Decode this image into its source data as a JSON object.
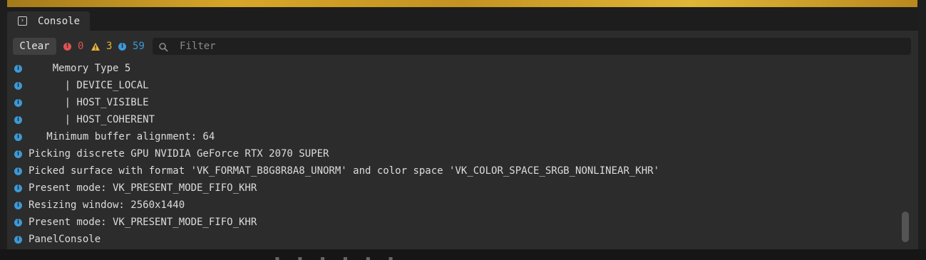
{
  "colors": {
    "error": "#e05252",
    "warning": "#e8b33a",
    "info": "#3c9ad8"
  },
  "tab": {
    "label": "Console",
    "icon": "terminal-icon"
  },
  "toolbar": {
    "clear_label": "Clear",
    "errors": {
      "icon": "error-icon",
      "count": "0"
    },
    "warnings": {
      "icon": "warning-icon",
      "count": "3"
    },
    "infos": {
      "icon": "info-icon",
      "count": "59"
    },
    "filter": {
      "icon": "search-icon",
      "placeholder": "Filter",
      "value": ""
    }
  },
  "log": [
    {
      "level": "info",
      "text": "    Memory Type 5"
    },
    {
      "level": "info",
      "text": "      | DEVICE_LOCAL"
    },
    {
      "level": "info",
      "text": "      | HOST_VISIBLE"
    },
    {
      "level": "info",
      "text": "      | HOST_COHERENT"
    },
    {
      "level": "info",
      "text": "   Minimum buffer alignment: 64"
    },
    {
      "level": "info",
      "text": "Picking discrete GPU NVIDIA GeForce RTX 2070 SUPER"
    },
    {
      "level": "info",
      "text": "Picked surface with format 'VK_FORMAT_B8G8R8A8_UNORM' and color space 'VK_COLOR_SPACE_SRGB_NONLINEAR_KHR'"
    },
    {
      "level": "info",
      "text": "Present mode: VK_PRESENT_MODE_FIFO_KHR"
    },
    {
      "level": "info",
      "text": "Resizing window: 2560x1440"
    },
    {
      "level": "info",
      "text": "Present mode: VK_PRESENT_MODE_FIFO_KHR"
    },
    {
      "level": "info",
      "text": "PanelConsole"
    }
  ]
}
